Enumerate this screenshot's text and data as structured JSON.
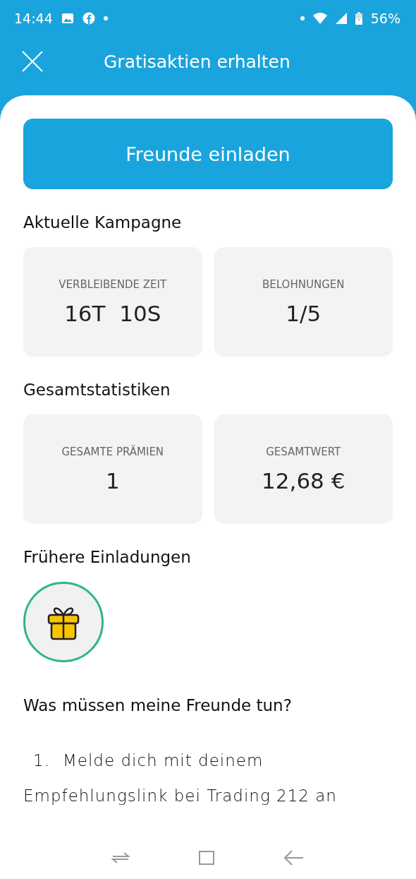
{
  "status_bar": {
    "time": "14:44",
    "battery": "56%"
  },
  "header": {
    "title": "Gratisaktien erhalten"
  },
  "invite_button": "Freunde einladen",
  "sections": [
    {
      "title": "Aktuelle Kampagne",
      "cards": [
        {
          "label": "VERBLEIBENDE ZEIT",
          "value": "16T  10S"
        },
        {
          "label": "BELOHNUNGEN",
          "value": "1/5"
        }
      ]
    },
    {
      "title": "Gesamtstatistiken",
      "cards": [
        {
          "label": "GESAMTE PRÄMIEN",
          "value": "1"
        },
        {
          "label": "GESAMTWERT",
          "value": "12,68 €"
        }
      ]
    }
  ],
  "past_invitations": {
    "title": "Frühere Einladungen",
    "items": [
      {
        "kind": "gift"
      }
    ]
  },
  "faq": {
    "title": "Was müssen meine Freunde tun?",
    "steps": [
      {
        "number": "1.",
        "text": "Melde dich mit deinem Empfehlungslink bei Trading 212 an"
      }
    ]
  }
}
